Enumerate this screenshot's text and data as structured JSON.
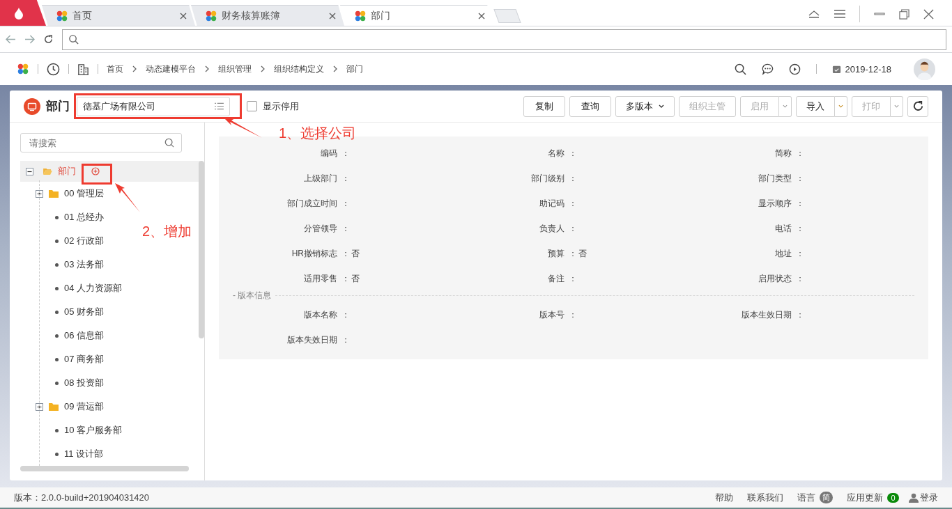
{
  "browser": {
    "tabs": [
      {
        "title": "首页",
        "selected": false
      },
      {
        "title": "财务核算账簿",
        "selected": false
      },
      {
        "title": "部门",
        "selected": true
      }
    ]
  },
  "header": {
    "breadcrumb": [
      "首页",
      "动态建模平台",
      "组织管理",
      "组织结构定义",
      "部门"
    ],
    "date": "2019-12-18"
  },
  "page": {
    "title": "部门",
    "company_field": {
      "value": "德基广场有限公司"
    },
    "show_disabled": {
      "label": "显示停用",
      "checked": false
    },
    "buttons": [
      {
        "label": "复制",
        "kind": "plain",
        "disabled": false
      },
      {
        "label": "查询",
        "kind": "plain",
        "disabled": false
      },
      {
        "label": "多版本",
        "kind": "menu",
        "disabled": false
      },
      {
        "label": "组织主管",
        "kind": "plain",
        "disabled": true
      },
      {
        "label": "启用",
        "kind": "split",
        "disabled": true
      },
      {
        "label": "导入",
        "kind": "split",
        "disabled": false
      },
      {
        "label": "打印",
        "kind": "split",
        "disabled": true
      }
    ]
  },
  "tree": {
    "search": {
      "placeholder": "请搜索"
    },
    "root": {
      "label": "部门",
      "selected": true,
      "expanded": true,
      "children": [
        {
          "label": "00 管理层",
          "kind": "folder",
          "expanded": false,
          "selected": false
        },
        {
          "label": "01 总经办",
          "kind": "leaf",
          "selected": false
        },
        {
          "label": "02 行政部",
          "kind": "leaf",
          "selected": false
        },
        {
          "label": "03 法务部",
          "kind": "leaf",
          "selected": false
        },
        {
          "label": "04 人力资源部",
          "kind": "leaf",
          "selected": false
        },
        {
          "label": "05 财务部",
          "kind": "leaf",
          "selected": false
        },
        {
          "label": "06 信息部",
          "kind": "leaf",
          "selected": false
        },
        {
          "label": "07 商务部",
          "kind": "leaf",
          "selected": false
        },
        {
          "label": "08 投资部",
          "kind": "leaf",
          "selected": false
        },
        {
          "label": "09 营运部",
          "kind": "folder",
          "expanded": false,
          "selected": false
        },
        {
          "label": "10 客户服务部",
          "kind": "leaf",
          "selected": false
        },
        {
          "label": "11 设计部",
          "kind": "leaf",
          "selected": false
        }
      ]
    }
  },
  "form": {
    "fields": [
      {
        "label": "编码",
        "colon": "："
      },
      {
        "label": "名称",
        "colon": "："
      },
      {
        "label": "简称",
        "colon": "："
      },
      {
        "label": "上级部门",
        "colon": "："
      },
      {
        "label": "部门级别",
        "colon": "："
      },
      {
        "label": "部门类型",
        "colon": "："
      },
      {
        "label": "部门成立时间",
        "colon": "："
      },
      {
        "label": "助记码",
        "colon": "："
      },
      {
        "label": "显示顺序",
        "colon": "："
      },
      {
        "label": "分管领导",
        "colon": "："
      },
      {
        "label": "负责人",
        "colon": "："
      },
      {
        "label": "电话",
        "colon": "："
      },
      {
        "label": "HR撤销标志",
        "colon": "：",
        "value": "否"
      },
      {
        "label": "预算",
        "colon": "：",
        "value": "否"
      },
      {
        "label": "地址",
        "colon": "："
      },
      {
        "label": "适用零售",
        "colon": "：",
        "value": "否"
      },
      {
        "label": "备注",
        "colon": "："
      },
      {
        "label": "启用状态",
        "colon": "："
      }
    ],
    "version_section": {
      "title": "- 版本信息",
      "fields": [
        {
          "label": "版本名称",
          "colon": "："
        },
        {
          "label": "版本号",
          "colon": "："
        },
        {
          "label": "版本生效日期",
          "colon": "："
        },
        {
          "label": "版本失效日期",
          "colon": "："
        }
      ]
    }
  },
  "annotations": [
    {
      "text": "1、选择公司"
    },
    {
      "text": "2、增加"
    }
  ],
  "status_bar": {
    "version": "版本：2.0.0-build+201904031420",
    "help": "帮助",
    "contact": "联系我们",
    "language": {
      "label": "语言",
      "badge": "简"
    },
    "updates": {
      "label": "应用更新",
      "badge": "0"
    },
    "login": "登录"
  }
}
